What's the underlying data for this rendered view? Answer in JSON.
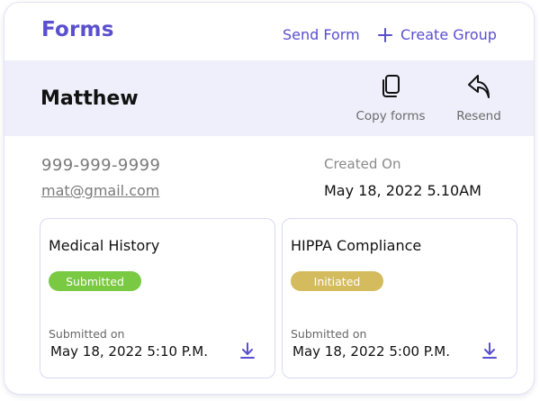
{
  "header": {
    "title": "Forms",
    "send_form_label": "Send Form",
    "create_group_label": "Create Group"
  },
  "contact": {
    "name": "Matthew",
    "phone": "999-999-9999",
    "email": "mat@gmail.com",
    "created_label": "Created On",
    "created_value": "May 18, 2022 5.10AM"
  },
  "actions": {
    "copy_label": "Copy forms",
    "resend_label": "Resend"
  },
  "forms": [
    {
      "title": "Medical History",
      "status": "Submitted",
      "status_color": "#7ac943",
      "sub_label": "Submitted on",
      "date": "May 18, 2022 5:10 P.M."
    },
    {
      "title": "HIPPA Compliance",
      "status": "Initiated",
      "status_color": "#d4bb5e",
      "sub_label": "Submitted on",
      "date": "May 18, 2022 5:00 P.M."
    }
  ],
  "colors": {
    "accent": "#5a4fcf",
    "header_band": "#eeeffa"
  },
  "icons": [
    "plus-icon",
    "copy-icon",
    "reply-icon",
    "download-icon"
  ]
}
